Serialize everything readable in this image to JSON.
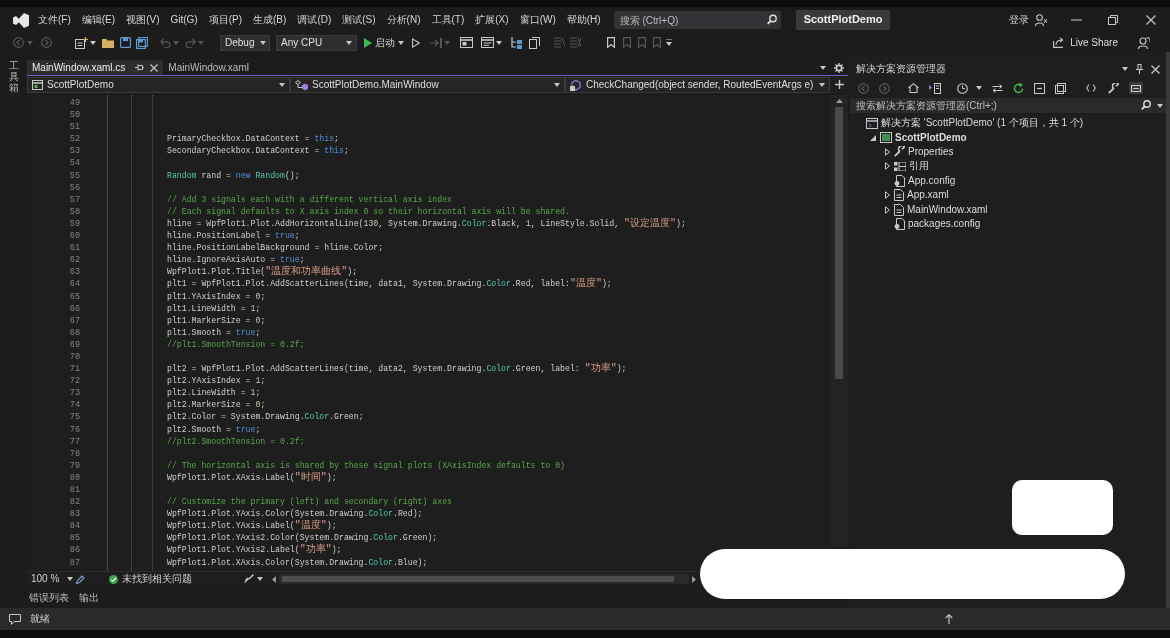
{
  "title_bar": {
    "menu": [
      "文件(F)",
      "编辑(E)",
      "视图(V)",
      "Git(G)",
      "项目(P)",
      "生成(B)",
      "调试(D)",
      "测试(S)",
      "分析(N)",
      "工具(T)",
      "扩展(X)",
      "窗口(W)",
      "帮助(H)"
    ],
    "search": {
      "placeholder": "搜索 (Ctrl+Q)"
    },
    "solution_name": "ScottPlotDemo",
    "sign_in": "登录"
  },
  "toolbar": {
    "configuration": "Debug",
    "platform": "Any CPU",
    "start": "启动",
    "live_share": "Live Share"
  },
  "side_tabs": [
    "工具箱"
  ],
  "editor": {
    "tabs": [
      {
        "label": "MainWindow.xaml.cs",
        "selected": true
      },
      {
        "label": "MainWindow.xaml",
        "selected": false
      }
    ],
    "navigation": [
      "ScottPlotDemo",
      "ScottPlotDemo.MainWindow",
      "CheckChanged(object sender, RoutedEventArgs e)"
    ],
    "lines": [
      {
        "number": "49"
      },
      {
        "number": "50"
      },
      {
        "number": "51"
      },
      {
        "number": "52",
        "tokens": [
          {
            "kind": "plain",
            "text": "PrimaryCheckbox.DataContext = "
          },
          {
            "kind": "keyword",
            "text": "this"
          },
          {
            "kind": "plain",
            "text": ";"
          }
        ]
      },
      {
        "number": "53",
        "tokens": [
          {
            "kind": "plain",
            "text": "SecondaryCheckbox.DataContext = "
          },
          {
            "kind": "keyword",
            "text": "this"
          },
          {
            "kind": "plain",
            "text": ";"
          }
        ]
      },
      {
        "number": "54"
      },
      {
        "number": "55",
        "tokens": [
          {
            "kind": "type",
            "text": "Random"
          },
          {
            "kind": "plain",
            "text": " rand = "
          },
          {
            "kind": "keyword",
            "text": "new "
          },
          {
            "kind": "type",
            "text": "Random"
          },
          {
            "kind": "plain",
            "text": "();"
          }
        ]
      },
      {
        "number": "56"
      },
      {
        "number": "57",
        "tokens": [
          {
            "kind": "comment",
            "text": "// Add 3 signals each with a different vertical axis index"
          }
        ]
      },
      {
        "number": "58",
        "tokens": [
          {
            "kind": "comment",
            "text": "// Each signal defaults to X axis index 0 so their horizontal axis will be shared."
          }
        ]
      },
      {
        "number": "59",
        "tokens": [
          {
            "kind": "plain",
            "text": "hline = WpfPlot1.Plot.AddHorizontalLine("
          },
          {
            "kind": "number",
            "text": "130"
          },
          {
            "kind": "plain",
            "text": ", System.Drawing."
          },
          {
            "kind": "type",
            "text": "Color"
          },
          {
            "kind": "plain",
            "text": ".Black, "
          },
          {
            "kind": "number",
            "text": "1"
          },
          {
            "kind": "plain",
            "text": ", LineStyle.Solid, "
          },
          {
            "kind": "string",
            "text": "\"设定温度\""
          },
          {
            "kind": "plain",
            "text": ");"
          }
        ]
      },
      {
        "number": "60",
        "tokens": [
          {
            "kind": "plain",
            "text": "hline.PositionLabel = "
          },
          {
            "kind": "keyword",
            "text": "true"
          },
          {
            "kind": "plain",
            "text": ";"
          }
        ]
      },
      {
        "number": "61",
        "tokens": [
          {
            "kind": "plain",
            "text": "hline.PositionLabelBackground = hline.Color;"
          }
        ]
      },
      {
        "number": "62",
        "tokens": [
          {
            "kind": "plain",
            "text": "hline.IgnoreAxisAuto = "
          },
          {
            "kind": "keyword",
            "text": "true"
          },
          {
            "kind": "plain",
            "text": ";"
          }
        ]
      },
      {
        "number": "63",
        "tokens": [
          {
            "kind": "plain",
            "text": "WpfPlot1.Plot.Title("
          },
          {
            "kind": "string",
            "text": "\"温度和功率曲线\""
          },
          {
            "kind": "plain",
            "text": ");"
          }
        ]
      },
      {
        "number": "64",
        "tokens": [
          {
            "kind": "plain",
            "text": "plt1 = WpfPlot1.Plot.AddScatterLines(time, data1, System.Drawing."
          },
          {
            "kind": "type",
            "text": "Color"
          },
          {
            "kind": "plain",
            "text": ".Red, label:"
          },
          {
            "kind": "string",
            "text": "\"温度\""
          },
          {
            "kind": "plain",
            "text": ");"
          }
        ]
      },
      {
        "number": "65",
        "tokens": [
          {
            "kind": "plain",
            "text": "plt1.YAxisIndex = "
          },
          {
            "kind": "number",
            "text": "0"
          },
          {
            "kind": "plain",
            "text": ";"
          }
        ]
      },
      {
        "number": "66",
        "tokens": [
          {
            "kind": "plain",
            "text": "plt1.LineWidth = "
          },
          {
            "kind": "number",
            "text": "1"
          },
          {
            "kind": "plain",
            "text": ";"
          }
        ]
      },
      {
        "number": "67",
        "tokens": [
          {
            "kind": "plain",
            "text": "plt1.MarkerSize = "
          },
          {
            "kind": "number",
            "text": "0"
          },
          {
            "kind": "plain",
            "text": ";"
          }
        ]
      },
      {
        "number": "68",
        "tokens": [
          {
            "kind": "plain",
            "text": "plt1.Smooth = "
          },
          {
            "kind": "keyword",
            "text": "true"
          },
          {
            "kind": "plain",
            "text": ";"
          }
        ]
      },
      {
        "number": "69",
        "tokens": [
          {
            "kind": "comment",
            "text": "//plt1.SmoothTension = 0.2f;"
          }
        ]
      },
      {
        "number": "70"
      },
      {
        "number": "71",
        "tokens": [
          {
            "kind": "plain",
            "text": "plt2 = WpfPlot1.Plot.AddScatterLines(time, data2, System.Drawing."
          },
          {
            "kind": "type",
            "text": "Color"
          },
          {
            "kind": "plain",
            "text": ".Green, label: "
          },
          {
            "kind": "string",
            "text": "\"功率\""
          },
          {
            "kind": "plain",
            "text": ");"
          }
        ]
      },
      {
        "number": "72",
        "tokens": [
          {
            "kind": "plain",
            "text": "plt2.YAxisIndex = "
          },
          {
            "kind": "number",
            "text": "1"
          },
          {
            "kind": "plain",
            "text": ";"
          }
        ]
      },
      {
        "number": "73",
        "tokens": [
          {
            "kind": "plain",
            "text": "plt2.LineWidth = "
          },
          {
            "kind": "number",
            "text": "1"
          },
          {
            "kind": "plain",
            "text": ";"
          }
        ]
      },
      {
        "number": "74",
        "tokens": [
          {
            "kind": "plain",
            "text": "plt2.MarkerSize = "
          },
          {
            "kind": "number",
            "text": "0"
          },
          {
            "kind": "plain",
            "text": ";"
          }
        ]
      },
      {
        "number": "75",
        "tokens": [
          {
            "kind": "plain",
            "text": "plt2.Color = System.Drawing."
          },
          {
            "kind": "type",
            "text": "Color"
          },
          {
            "kind": "plain",
            "text": ".Green;"
          }
        ]
      },
      {
        "number": "76",
        "tokens": [
          {
            "kind": "plain",
            "text": "plt2.Smooth = "
          },
          {
            "kind": "keyword",
            "text": "true"
          },
          {
            "kind": "plain",
            "text": ";"
          }
        ]
      },
      {
        "number": "77",
        "tokens": [
          {
            "kind": "comment",
            "text": "//plt2.SmoothTension = 0.2f;"
          }
        ]
      },
      {
        "number": "78"
      },
      {
        "number": "79",
        "tokens": [
          {
            "kind": "comment",
            "text": "// The horizontal axis is shared by these signal plots (XAxisIndex defaults to 0)"
          }
        ]
      },
      {
        "number": "80",
        "tokens": [
          {
            "kind": "plain",
            "text": "WpfPlot1.Plot.XAxis.Label("
          },
          {
            "kind": "string",
            "text": "\"时间\""
          },
          {
            "kind": "plain",
            "text": ");"
          }
        ]
      },
      {
        "number": "81"
      },
      {
        "number": "82",
        "tokens": [
          {
            "kind": "comment",
            "text": "// Customize the primary (left) and secondary (right) axes"
          }
        ]
      },
      {
        "number": "83",
        "tokens": [
          {
            "kind": "plain",
            "text": "WpfPlot1.Plot.YAxis.Color(System.Drawing."
          },
          {
            "kind": "type",
            "text": "Color"
          },
          {
            "kind": "plain",
            "text": ".Red);"
          }
        ]
      },
      {
        "number": "84",
        "tokens": [
          {
            "kind": "plain",
            "text": "WpfPlot1.Plot.YAxis.Label("
          },
          {
            "kind": "string",
            "text": "\"温度\""
          },
          {
            "kind": "plain",
            "text": ");"
          }
        ]
      },
      {
        "number": "85",
        "tokens": [
          {
            "kind": "plain",
            "text": "WpfPlot1.Plot.YAxis2.Color(System.Drawing."
          },
          {
            "kind": "type",
            "text": "Color"
          },
          {
            "kind": "plain",
            "text": ".Green);"
          }
        ]
      },
      {
        "number": "86",
        "tokens": [
          {
            "kind": "plain",
            "text": "WpfPlot1.Plot.YAxis2.Label("
          },
          {
            "kind": "string",
            "text": "\"功率\""
          },
          {
            "kind": "plain",
            "text": ");"
          }
        ]
      },
      {
        "number": "87",
        "tokens": [
          {
            "kind": "plain",
            "text": "WpfPlot1.Plot.XAxis.Color(System.Drawing."
          },
          {
            "kind": "type",
            "text": "Color"
          },
          {
            "kind": "plain",
            "text": ".Blue);"
          }
        ]
      }
    ],
    "zoom": "100 %",
    "issues": "未找到相关问题"
  },
  "bottom_tabs": [
    "错误列表",
    "输出"
  ],
  "solution_explorer": {
    "title": "解决方案资源管理器",
    "search": {
      "placeholder": "搜索解决方案资源管理器(Ctrl+;)"
    },
    "tree": [
      {
        "kind": "solution",
        "label": "解决方案 'ScottPlotDemo' (1 个项目，共 1 个)",
        "children": [
          {
            "kind": "project",
            "label": "ScottPlotDemo",
            "expanded": true,
            "children": [
              {
                "kind": "properties",
                "label": "Properties",
                "expanded": false
              },
              {
                "kind": "references",
                "label": "引用",
                "expanded": false
              },
              {
                "kind": "config-file",
                "label": "App.config"
              },
              {
                "kind": "xaml-file",
                "label": "App.xaml",
                "expanded": false
              },
              {
                "kind": "xaml-file",
                "label": "MainWindow.xaml",
                "expanded": false
              },
              {
                "kind": "config-file",
                "label": "packages.config"
              }
            ]
          }
        ]
      }
    ]
  },
  "status_bar": {
    "text": "就绪"
  }
}
